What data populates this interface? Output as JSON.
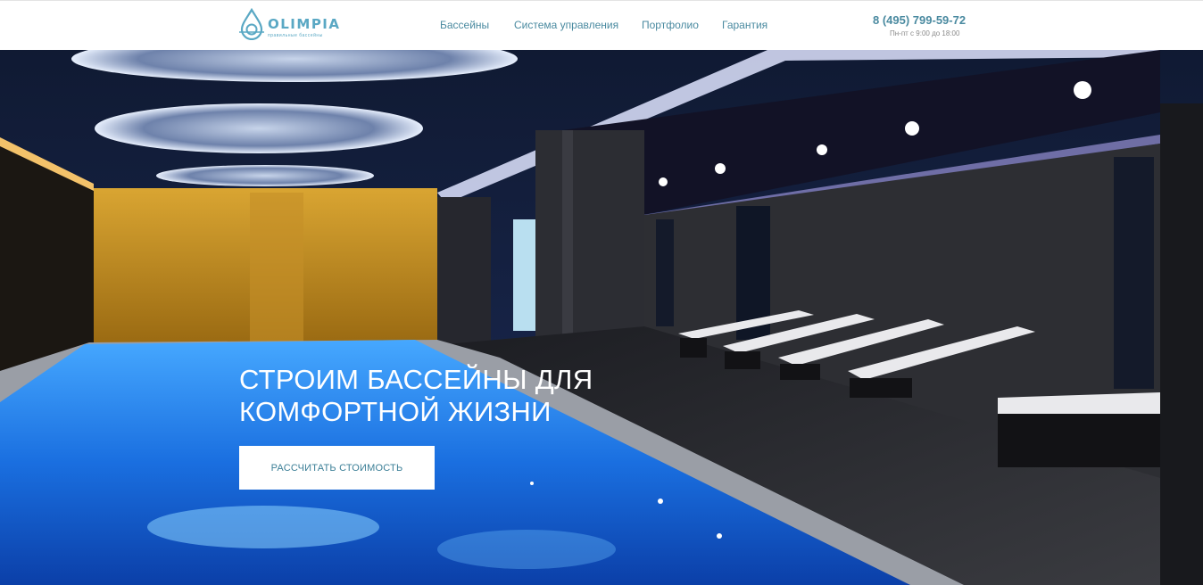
{
  "brand": {
    "name": "OLIMPIA",
    "tagline": "правильные бассейны",
    "accent": "#5aa8c4"
  },
  "nav": {
    "items": [
      {
        "label": "Бассейны"
      },
      {
        "label": "Система управления"
      },
      {
        "label": "Портфолио"
      },
      {
        "label": "Гарантия"
      }
    ]
  },
  "contact": {
    "phone": "8 (495) 799-59-72",
    "hours": "Пн-пт с 9:00 до 18:00"
  },
  "hero": {
    "headline_line1": "СТРОИМ БАССЕЙНЫ ДЛЯ",
    "headline_line2": "КОМФОРТНОЙ ЖИЗНИ",
    "cta_label": "РАССЧИТАТЬ СТОИМОСТЬ",
    "image_subject": "indoor-pool-photo"
  }
}
